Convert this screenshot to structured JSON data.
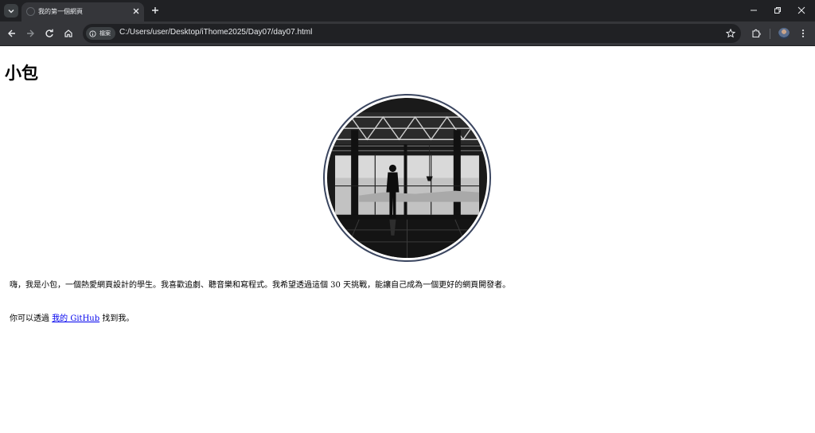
{
  "browser": {
    "tab": {
      "title": "我的第一個網頁"
    },
    "omnibox": {
      "chip_label": "檔案",
      "url": "C:/Users/user/Desktop/iThome2025/Day07/day07.html"
    },
    "icons": {
      "tab_search": "chevron-down-icon",
      "tab_close": "close-icon",
      "new_tab": "plus-icon",
      "back": "arrow-left-icon",
      "forward": "arrow-right-icon",
      "reload": "reload-icon",
      "home": "home-icon",
      "site_info": "info-icon",
      "bookmark": "star-icon",
      "extensions": "puzzle-icon",
      "menu": "kebab-menu-icon"
    },
    "colors": {
      "tabstrip": "#202124",
      "toolbar": "#35363a",
      "omnibox": "#202124"
    }
  },
  "page": {
    "heading": "小包",
    "intro": "嗨，我是小包，一個熱愛網頁設計的學生。我喜歡追劇、聽音樂和寫程式。我希望透過這個 30 天挑戰，能讓自己成為一個更好的網頁開發者。",
    "github_prefix": "你可以透過 ",
    "github_link": "我的 GitHub",
    "github_suffix": " 找到我。",
    "link_color": "#0000ee"
  }
}
